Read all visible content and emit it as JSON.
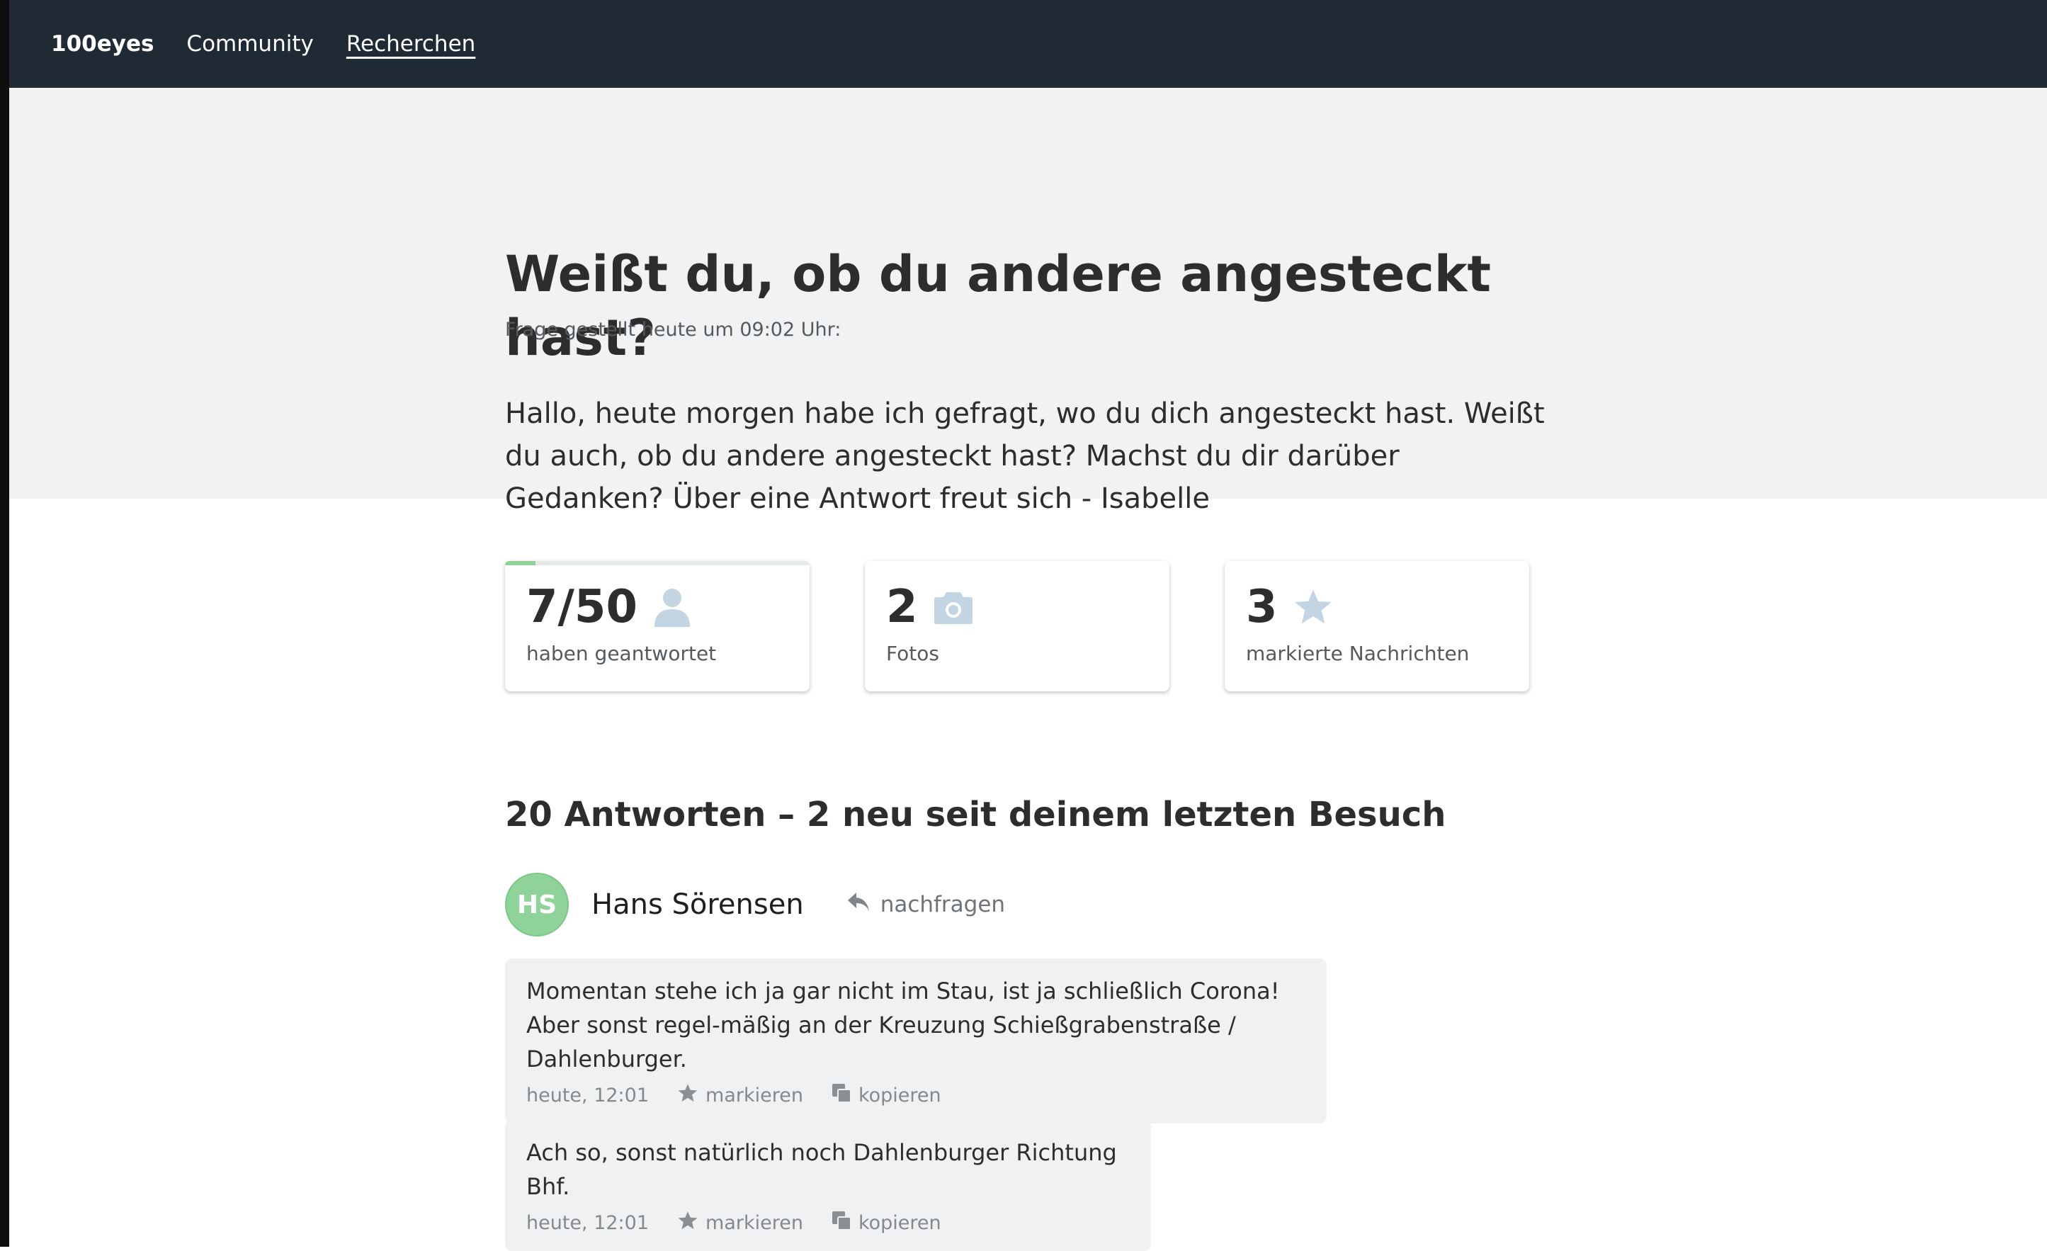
{
  "nav": {
    "brand": "100eyes",
    "items": [
      "Community",
      "Recherchen"
    ]
  },
  "request": {
    "title": "Weißt du, ob du andere angesteckt hast?",
    "asked": "Frage gestellt heute um 09:02 Uhr:",
    "text": "Hallo, heute morgen habe ich gefragt, wo du dich angesteckt hast. Weißt du auch, ob du andere angesteckt hast? Machst du dir darüber Gedanken? Über eine Antwort freut sich - Isabelle"
  },
  "stats": [
    {
      "value": "7/50",
      "label": "haben geantwortet",
      "icon": "user-icon",
      "progress": 0.1
    },
    {
      "value": "2",
      "label": "Fotos",
      "icon": "camera-icon"
    },
    {
      "value": "3",
      "label": "markierte Nachrichten",
      "icon": "star-icon"
    }
  ],
  "answers": {
    "heading": "20 Antworten – 2 neu seit deinem letzten Besuch",
    "author": {
      "initials": "HS",
      "name": "Hans Sörensen",
      "followup": "nachfragen"
    },
    "messages": [
      {
        "text": "Momentan stehe ich ja gar nicht im Stau, ist ja schließlich Corona! Aber sonst regel-mäßig an der Kreuzung Schießgrabenstraße / Dahlenburger.",
        "time": "heute, 12:01",
        "highlight": "markieren",
        "copy": "kopieren"
      },
      {
        "text": "Ach so, sonst natürlich noch Dahlenburger Richtung Bhf.",
        "time": "heute, 12:01",
        "highlight": "markieren",
        "copy": "kopieren"
      }
    ]
  },
  "colors": {
    "nav_bg": "#1f2a35",
    "hero_bg": "#f1f2f3",
    "accent_green": "#8fd39a",
    "icon_blue": "#c3d4e3"
  }
}
